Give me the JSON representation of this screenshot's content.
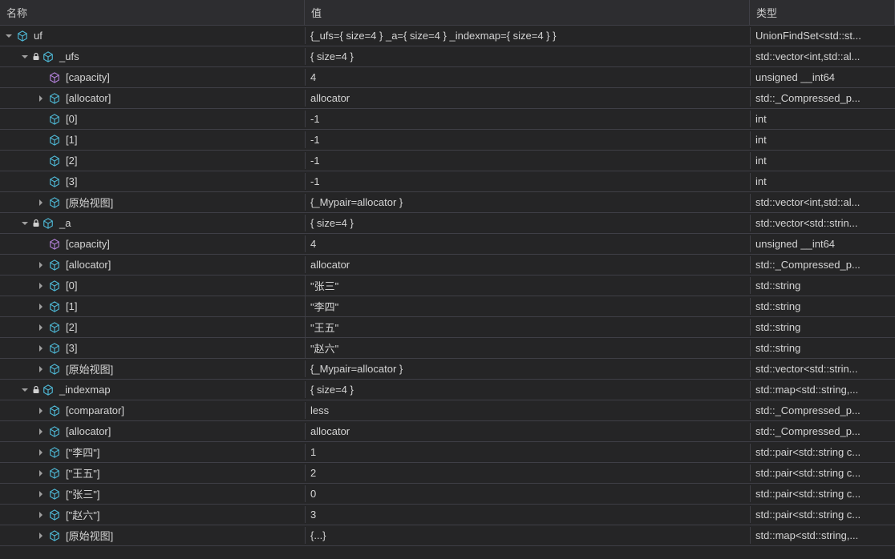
{
  "headers": {
    "name": "名称",
    "value": "值",
    "type": "类型"
  },
  "rows": [
    {
      "indent": 0,
      "exp": "open",
      "icon": "cube-blue",
      "lock": false,
      "name": "uf",
      "value": "{_ufs={ size=4 } _a={ size=4 } _indexmap={ size=4 } }",
      "vclass": "value-red",
      "type": "UnionFindSet<std::st..."
    },
    {
      "indent": 1,
      "exp": "open",
      "icon": "cube-blue",
      "lock": true,
      "name": "_ufs",
      "value": "{ size=4 }",
      "vclass": "",
      "type": "std::vector<int,std::al..."
    },
    {
      "indent": 2,
      "exp": "none",
      "icon": "cube-purple",
      "lock": false,
      "name": "[capacity]",
      "value": "4",
      "vclass": "",
      "type": "unsigned __int64"
    },
    {
      "indent": 2,
      "exp": "closed",
      "icon": "cube-blue",
      "lock": false,
      "name": "[allocator]",
      "value": "allocator",
      "vclass": "",
      "type": "std::_Compressed_p..."
    },
    {
      "indent": 2,
      "exp": "none",
      "icon": "cube-blue",
      "lock": false,
      "name": "[0]",
      "value": "-1",
      "vclass": "",
      "type": "int"
    },
    {
      "indent": 2,
      "exp": "none",
      "icon": "cube-blue",
      "lock": false,
      "name": "[1]",
      "value": "-1",
      "vclass": "",
      "type": "int"
    },
    {
      "indent": 2,
      "exp": "none",
      "icon": "cube-blue",
      "lock": false,
      "name": "[2]",
      "value": "-1",
      "vclass": "",
      "type": "int"
    },
    {
      "indent": 2,
      "exp": "none",
      "icon": "cube-blue",
      "lock": false,
      "name": "[3]",
      "value": "-1",
      "vclass": "",
      "type": "int"
    },
    {
      "indent": 2,
      "exp": "closed",
      "icon": "cube-blue",
      "lock": false,
      "name": "[原始视图]",
      "value": "{_Mypair=allocator }",
      "vclass": "",
      "type": "std::vector<int,std::al..."
    },
    {
      "indent": 1,
      "exp": "open",
      "icon": "cube-blue",
      "lock": true,
      "name": "_a",
      "value": "{ size=4 }",
      "vclass": "",
      "type": "std::vector<std::strin..."
    },
    {
      "indent": 2,
      "exp": "none",
      "icon": "cube-purple",
      "lock": false,
      "name": "[capacity]",
      "value": "4",
      "vclass": "",
      "type": "unsigned __int64"
    },
    {
      "indent": 2,
      "exp": "closed",
      "icon": "cube-blue",
      "lock": false,
      "name": "[allocator]",
      "value": "allocator",
      "vclass": "",
      "type": "std::_Compressed_p..."
    },
    {
      "indent": 2,
      "exp": "closed",
      "icon": "cube-blue",
      "lock": false,
      "name": "[0]",
      "value": "\"张三\"",
      "vclass": "",
      "type": "std::string"
    },
    {
      "indent": 2,
      "exp": "closed",
      "icon": "cube-blue",
      "lock": false,
      "name": "[1]",
      "value": "\"李四\"",
      "vclass": "",
      "type": "std::string"
    },
    {
      "indent": 2,
      "exp": "closed",
      "icon": "cube-blue",
      "lock": false,
      "name": "[2]",
      "value": "\"王五\"",
      "vclass": "",
      "type": "std::string"
    },
    {
      "indent": 2,
      "exp": "closed",
      "icon": "cube-blue",
      "lock": false,
      "name": "[3]",
      "value": "\"赵六\"",
      "vclass": "",
      "type": "std::string"
    },
    {
      "indent": 2,
      "exp": "closed",
      "icon": "cube-blue",
      "lock": false,
      "name": "[原始视图]",
      "value": "{_Mypair=allocator }",
      "vclass": "",
      "type": "std::vector<std::strin..."
    },
    {
      "indent": 1,
      "exp": "open",
      "icon": "cube-blue",
      "lock": true,
      "name": "_indexmap",
      "value": "{ size=4 }",
      "vclass": "",
      "type": "std::map<std::string,..."
    },
    {
      "indent": 2,
      "exp": "closed",
      "icon": "cube-blue",
      "lock": false,
      "name": "[comparator]",
      "value": "less",
      "vclass": "",
      "type": "std::_Compressed_p..."
    },
    {
      "indent": 2,
      "exp": "closed",
      "icon": "cube-blue",
      "lock": false,
      "name": "[allocator]",
      "value": "allocator",
      "vclass": "",
      "type": "std::_Compressed_p..."
    },
    {
      "indent": 2,
      "exp": "closed",
      "icon": "cube-blue",
      "lock": false,
      "name": "[\"李四\"]",
      "value": "1",
      "vclass": "",
      "type": "std::pair<std::string c..."
    },
    {
      "indent": 2,
      "exp": "closed",
      "icon": "cube-blue",
      "lock": false,
      "name": "[\"王五\"]",
      "value": "2",
      "vclass": "",
      "type": "std::pair<std::string c..."
    },
    {
      "indent": 2,
      "exp": "closed",
      "icon": "cube-blue",
      "lock": false,
      "name": "[\"张三\"]",
      "value": "0",
      "vclass": "",
      "type": "std::pair<std::string c..."
    },
    {
      "indent": 2,
      "exp": "closed",
      "icon": "cube-blue",
      "lock": false,
      "name": "[\"赵六\"]",
      "value": "3",
      "vclass": "",
      "type": "std::pair<std::string c..."
    },
    {
      "indent": 2,
      "exp": "closed",
      "icon": "cube-blue",
      "lock": false,
      "name": "[原始视图]",
      "value": "{...}",
      "vclass": "",
      "type": "std::map<std::string,..."
    }
  ],
  "watermark": ""
}
